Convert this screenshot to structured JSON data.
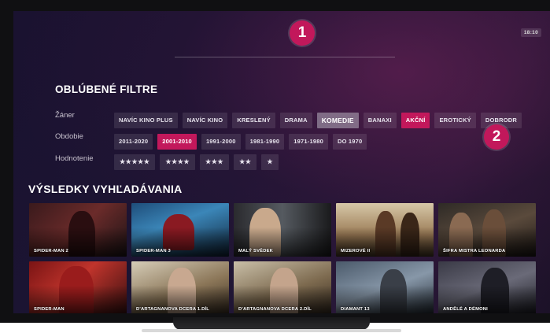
{
  "screen": {
    "clock": "18:10"
  },
  "badges": {
    "one": "1",
    "two": "2"
  },
  "filters": {
    "title": "OBLÚBENÉ FILTRE",
    "genre_label": "Žáner",
    "period_label": "Obdobie",
    "rating_label": "Hodnotenie",
    "genres": [
      "NAVÍC KINO PLUS",
      "NAVÍC KINO",
      "KRESLENÝ",
      "DRAMA",
      "KOMEDIE",
      "BANAXI",
      "AKČNÍ",
      "EROTICKÝ",
      "DOBRODR"
    ],
    "periods": [
      "2011-2020",
      "2001-2010",
      "1991-2000",
      "1981-1990",
      "1971-1980",
      "DO 1970"
    ],
    "ratings": [
      "★★★★★",
      "★★★★",
      "★★★",
      "★★",
      "★"
    ],
    "selected_genre_pink": "AKČNÍ",
    "selected_genre_highlight": "KOMEDIE",
    "selected_period": "2001-2010"
  },
  "results": {
    "title": "VÝSLEDKY VYHĽADÁVANIA",
    "row1": [
      "SPIDER-MAN 2",
      "SPIDER-MAN 3",
      "MALÝ SVĚDEK",
      "MIZEROVÉ II",
      "ŠIFRA MISTRA LEONARDA"
    ],
    "row2": [
      "SPIDER-MAN",
      "D'ARTAGNANOVA DCERA 1.DÍL",
      "D'ARTAGNANOVA DCERA 2.DÍL",
      "DIAMANT 13",
      "ANDĚLÉ A DÉMONI"
    ]
  },
  "colors": {
    "accent": "#c2185b",
    "background": "#1c1533"
  }
}
